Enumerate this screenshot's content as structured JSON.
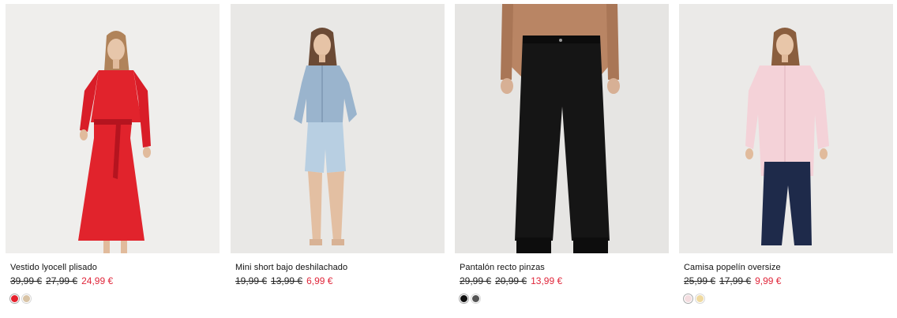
{
  "products": [
    {
      "name": "Vestido lyocell plisado",
      "old_prices": [
        "39,99 €",
        "27,99 €"
      ],
      "sale_price": "24,99 €",
      "swatches": [
        "#e5202c",
        "#d8c3a5"
      ],
      "image_bg": "#efeeec",
      "image_alt": "Vestido lyocell plisado"
    },
    {
      "name": "Mini short bajo deshilachado",
      "old_prices": [
        "19,99 €",
        "13,99 €"
      ],
      "sale_price": "6,99 €",
      "swatches": [],
      "image_bg": "#e9e8e6",
      "image_alt": "Mini short bajo deshilachado"
    },
    {
      "name": "Pantalón recto pinzas",
      "old_prices": [
        "29,99 €",
        "20,99 €"
      ],
      "sale_price": "13,99 €",
      "swatches": [
        "#111111",
        "#555555"
      ],
      "image_bg": "#e6e5e3",
      "image_alt": "Pantalón recto pinzas"
    },
    {
      "name": "Camisa popelín oversize",
      "old_prices": [
        "25,99 €",
        "17,99 €"
      ],
      "sale_price": "9,99 €",
      "swatches": [
        "#f4dde0",
        "#efd9a0"
      ],
      "image_bg": "#ebeae8",
      "image_alt": "Camisa popelín oversize"
    }
  ],
  "colors": {
    "sale": "#e0263a",
    "text": "#111111"
  }
}
